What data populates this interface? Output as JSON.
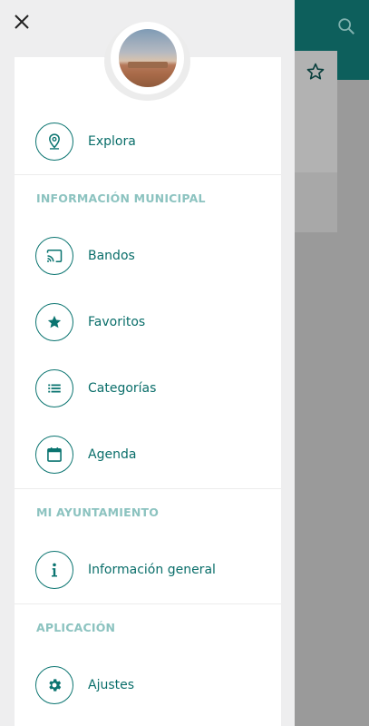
{
  "drawer": {
    "close_icon": "close-icon",
    "avatar_alt": "town-photo",
    "top_item": {
      "label": "Explora",
      "icon": "map-pin-icon"
    },
    "sections": [
      {
        "title": "INFORMACIÓN MUNICIPAL",
        "items": [
          {
            "label": "Bandos",
            "icon": "cast-icon"
          },
          {
            "label": "Favoritos",
            "icon": "star-icon"
          },
          {
            "label": "Categorías",
            "icon": "list-icon"
          },
          {
            "label": "Agenda",
            "icon": "calendar-icon"
          }
        ]
      },
      {
        "title": "MI AYUNTAMIENTO",
        "items": [
          {
            "label": "Información general",
            "icon": "info-icon"
          }
        ]
      },
      {
        "title": "APLICACIÓN",
        "items": [
          {
            "label": "Ajustes",
            "icon": "gear-icon"
          }
        ]
      }
    ]
  },
  "background": {
    "search_icon": "search-icon",
    "star_icon": "star-outline-icon"
  },
  "colors": {
    "accent": "#0a7470",
    "section_title": "#8cc3c0",
    "header_bg": "#0d5f5c"
  }
}
